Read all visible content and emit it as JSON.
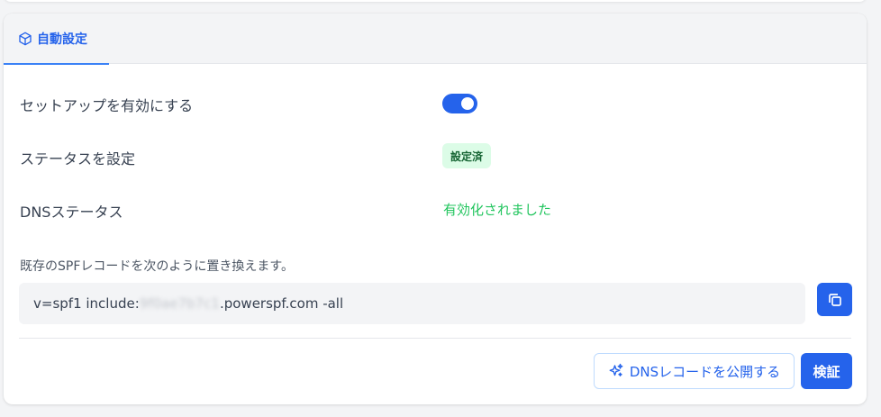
{
  "tab": {
    "label": "自動設定",
    "icon": "cube-icon"
  },
  "rows": {
    "setup_label": "セットアップを有効にする",
    "setup_enabled": true,
    "status_label": "ステータスを設定",
    "status_badge": "設定済",
    "dns_label": "DNSステータス",
    "dns_value": "有効化されました"
  },
  "spf": {
    "instruction": "既存のSPFレコードを次のように置き換えます。",
    "prefix": "v=spf1 include:",
    "redacted": "9f0ae7b7c1",
    "suffix": ".powerspf.com -all"
  },
  "actions": {
    "publish_label": "DNSレコードを公開する",
    "verify_label": "検証"
  },
  "colors": {
    "accent": "#2563eb",
    "success": "#22c55e",
    "badge_bg": "#dcfce7",
    "badge_text": "#166534"
  }
}
